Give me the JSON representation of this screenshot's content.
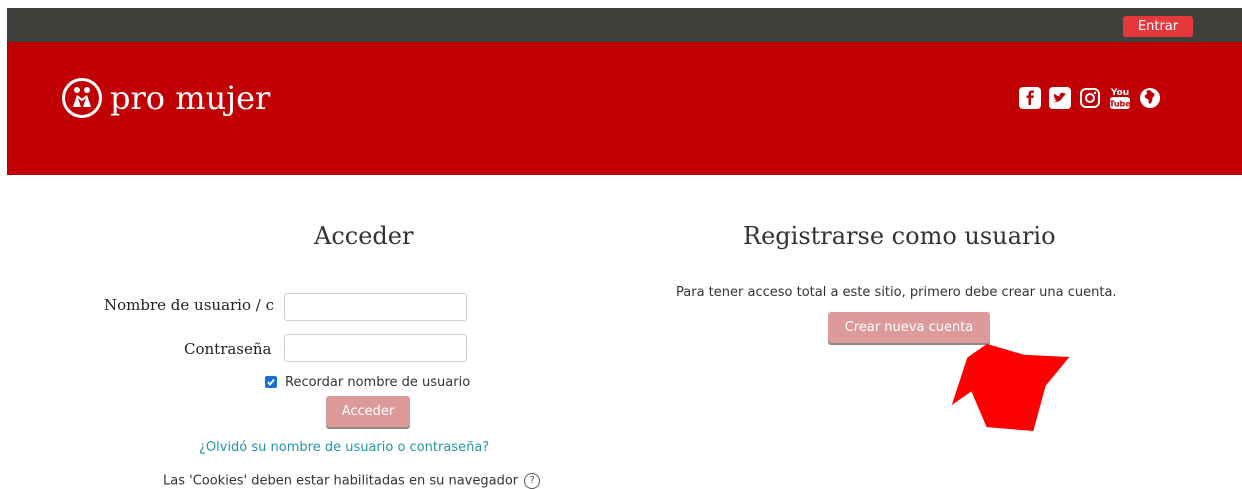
{
  "topbar": {
    "login_label": "Entrar"
  },
  "header": {
    "logo_text": "pro mujer",
    "social_icons": [
      "facebook-icon",
      "twitter-icon",
      "instagram-icon",
      "youtube-icon",
      "globe-icon"
    ],
    "youtube_text_top": "You",
    "youtube_text_bottom": "Tube"
  },
  "login": {
    "title": "Acceder",
    "username_label": "Nombre de usuario / c",
    "password_label": "Contraseña",
    "remember_label": "Recordar nombre de usuario",
    "remember_checked": true,
    "submit_label": "Acceder",
    "forgot_link": "¿Olvidó su nombre de usuario o contraseña?",
    "cookies_note": "Las 'Cookies' deben estar habilitadas en su navegador",
    "help_glyph": "?"
  },
  "signup": {
    "title": "Registrarse como usuario",
    "description": "Para tener acceso total a este sitio, primero debe crear una cuenta.",
    "button_label": "Crear nueva cuenta"
  },
  "colors": {
    "topbar": "#3f3f3c",
    "header": "#c10004",
    "login_button": "#e6393d",
    "primary_button": "#dd9a9b",
    "link": "#2196a6",
    "annotation_arrow": "#ff0000"
  }
}
